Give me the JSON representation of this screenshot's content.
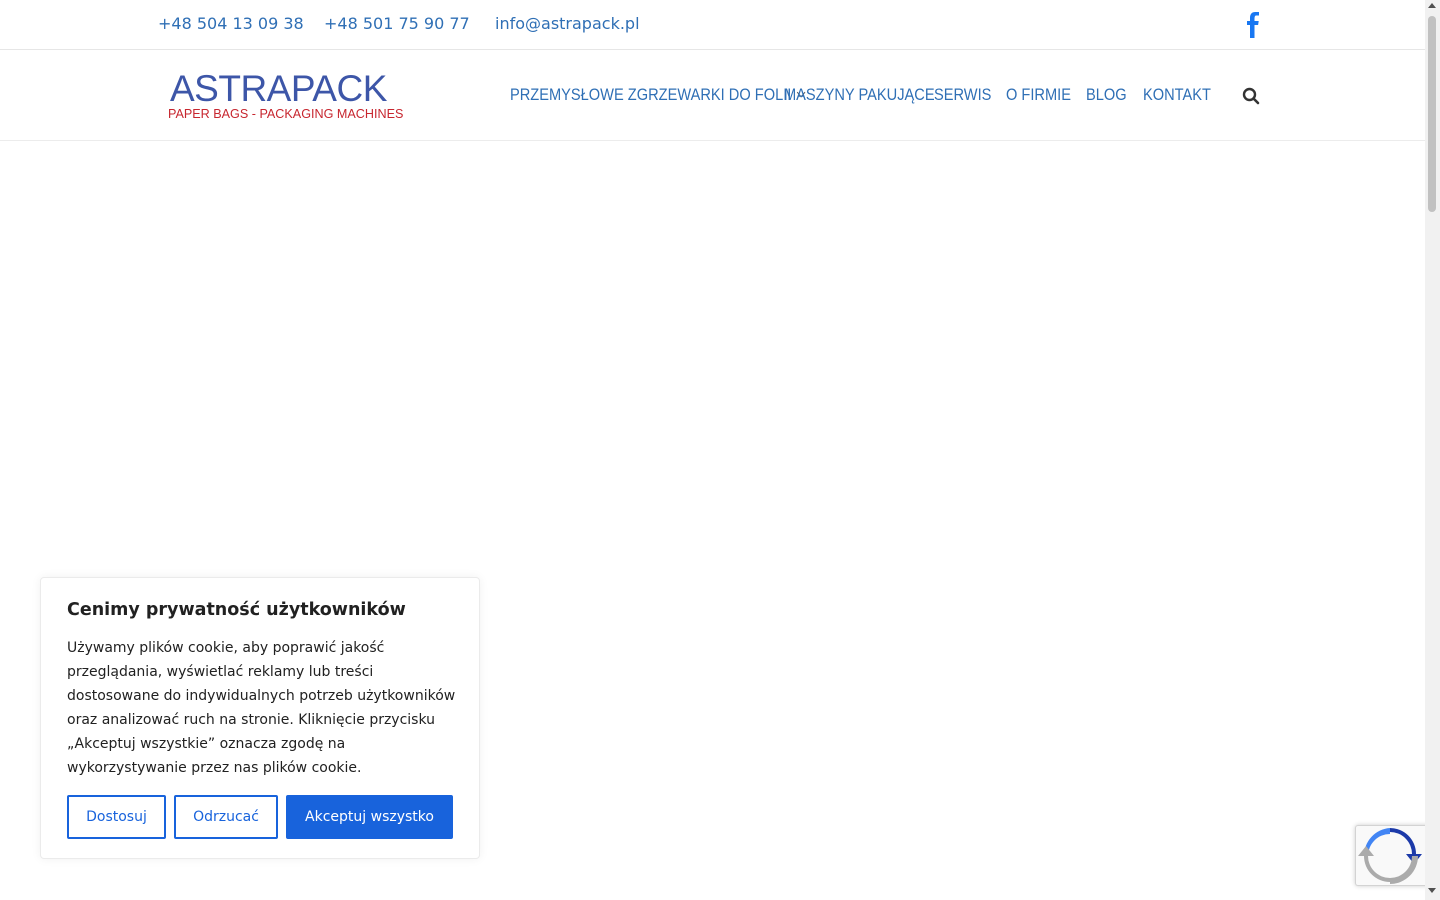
{
  "topbar": {
    "phone1": "+48 504 13 09 38",
    "phone2": "+48 501 75 90 77",
    "email": "info@astrapack.pl",
    "social_icon": "facebook-icon"
  },
  "logo": {
    "main": "ASTRAPACK",
    "sub": "PAPER BAGS - PACKAGING MACHINES"
  },
  "nav": {
    "items": [
      {
        "label": "PRZEMYSŁOWE ZGRZEWARKI DO FOLII",
        "has_dropdown": true
      },
      {
        "label": "MASZYNY PAKUJĄCE"
      },
      {
        "label": "SERWIS"
      },
      {
        "label": "O FIRMIE"
      },
      {
        "label": "BLOG"
      },
      {
        "label": "KONTAKT"
      }
    ],
    "search_icon": "search-icon"
  },
  "cookie": {
    "title": "Cenimy prywatność użytkowników",
    "text": "Używamy plików cookie, aby poprawić jakość przeglądania, wyświetlać reklamy lub treści dostosowane do indywidualnych potrzeb użytkowników oraz analizować ruch na stronie. Kliknięcie przycisku „Akceptuj wszystkie” oznacza zgodę na wykorzystywanie przez nas plików cookie.",
    "btn_customize": "Dostosuj",
    "btn_reject": "Odrzucać",
    "btn_accept": "Akceptuj wszystko"
  },
  "colors": {
    "link": "#2f6fb5",
    "accent": "#1863dc",
    "logo_blue": "#3d56a8",
    "logo_red": "#c7262f",
    "facebook": "#1877f2"
  },
  "recaptcha_icon": "recaptcha-icon"
}
